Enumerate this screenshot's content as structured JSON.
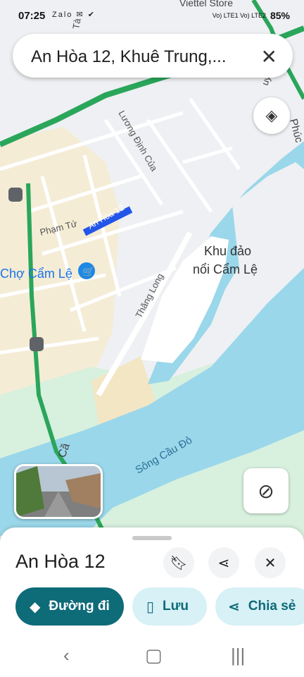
{
  "status": {
    "time": "07:25",
    "apps": "Zalo ✉ ✔",
    "carrier": "Viettel Store",
    "signal": "Vo) LTE1 Vo) LTE2",
    "battery": "85%"
  },
  "search": {
    "query": "An Hòa 12, Khuê Trung,...",
    "close_icon": "close-icon"
  },
  "map": {
    "labels": {
      "street_an_hoa": "An Hòa 12",
      "street_luong_dinh_cua": "Lương Định Của",
      "street_pham_tu": "Phạm Tứ",
      "street_thang_long": "Thăng Long",
      "market": "Chợ Cẩm Lệ",
      "island_line1": "Khu đảo",
      "island_line2": "nổi Cẩm Lệ",
      "river": "Sông Cầu Đỏ",
      "road_cau": "Cầ",
      "road_phuoc": "Phúc",
      "road_nguyen": "uyễn",
      "road_ta": "Tà"
    },
    "colors": {
      "water": "#9ad7ea",
      "park": "#d8f0de",
      "sand": "#f5e8c8",
      "highway": "#27a85a",
      "urban": "#f5ecd6"
    }
  },
  "sheet": {
    "title": "An Hòa 12",
    "actions": {
      "directions": "Đường đi",
      "save": "Lưu",
      "share": "Chia sẻ"
    }
  }
}
